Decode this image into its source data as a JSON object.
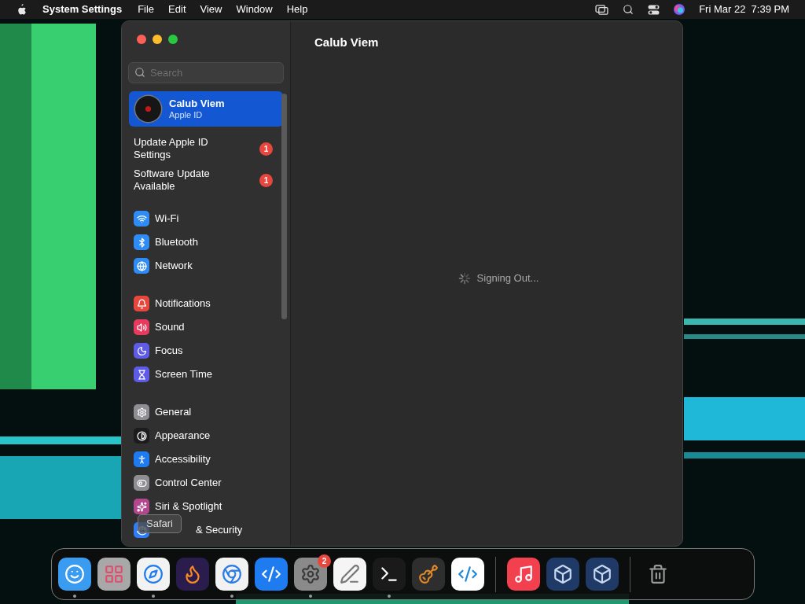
{
  "menu_bar": {
    "app": "System Settings",
    "menus": [
      "File",
      "Edit",
      "View",
      "Window",
      "Help"
    ],
    "clock": "Fri Mar 22  7:39 PM"
  },
  "window": {
    "title": "Calub Viem",
    "status": "Signing Out..."
  },
  "sidebar": {
    "search": {
      "placeholder": "Search"
    },
    "account": {
      "name": "Calub Viem",
      "subtitle": "Apple ID",
      "selected": true
    },
    "notices": [
      {
        "label": "Update Apple ID Settings",
        "badge": "1"
      },
      {
        "label": "Software Update Available",
        "badge": "1"
      }
    ],
    "sections": [
      {
        "items": [
          {
            "label": "Wi-Fi",
            "kind": "wifi",
            "color": "#2f8cf5"
          },
          {
            "label": "Bluetooth",
            "kind": "bluetooth",
            "color": "#2f8cf5"
          },
          {
            "label": "Network",
            "kind": "globe",
            "color": "#2f8cf5"
          }
        ]
      },
      {
        "items": [
          {
            "label": "Notifications",
            "kind": "bell",
            "color": "#e8473e"
          },
          {
            "label": "Sound",
            "kind": "speaker",
            "color": "#e83a5c"
          },
          {
            "label": "Focus",
            "kind": "moon",
            "color": "#5e5ce6"
          },
          {
            "label": "Screen Time",
            "kind": "hourglass",
            "color": "#5e5ce6"
          }
        ]
      },
      {
        "items": [
          {
            "label": "General",
            "kind": "gear",
            "color": "#8e8e93"
          },
          {
            "label": "Appearance",
            "kind": "contrast",
            "color": "#1c1c1e"
          },
          {
            "label": "Accessibility",
            "kind": "accessibility",
            "color": "#1f7cf0"
          },
          {
            "label": "Control Center",
            "kind": "toggle",
            "color": "#8e8e93"
          },
          {
            "label": "Siri & Spotlight",
            "kind": "siri",
            "color": "#b4468f"
          },
          {
            "label": "& Security",
            "kind": "hand",
            "color": "#2f7cf5",
            "covered": true
          }
        ]
      }
    ]
  },
  "tooltip": "Safari",
  "dock": [
    {
      "kind": "finder",
      "running": true
    },
    {
      "kind": "launchpad",
      "running": false
    },
    {
      "kind": "safari",
      "running": true
    },
    {
      "kind": "firefox",
      "running": false
    },
    {
      "kind": "chrome",
      "running": true
    },
    {
      "kind": "appstore",
      "running": false
    },
    {
      "kind": "settings",
      "running": true,
      "badge": "2"
    },
    {
      "kind": "textedit",
      "running": false
    },
    {
      "kind": "terminal",
      "running": true
    },
    {
      "kind": "garageband",
      "running": false
    },
    {
      "kind": "vscode",
      "running": false
    },
    {
      "kind": "separator"
    },
    {
      "kind": "music",
      "running": false
    },
    {
      "kind": "virtualbox",
      "running": false
    },
    {
      "kind": "virtualbox",
      "running": false
    },
    {
      "kind": "separator"
    },
    {
      "kind": "trash",
      "running": false
    }
  ]
}
